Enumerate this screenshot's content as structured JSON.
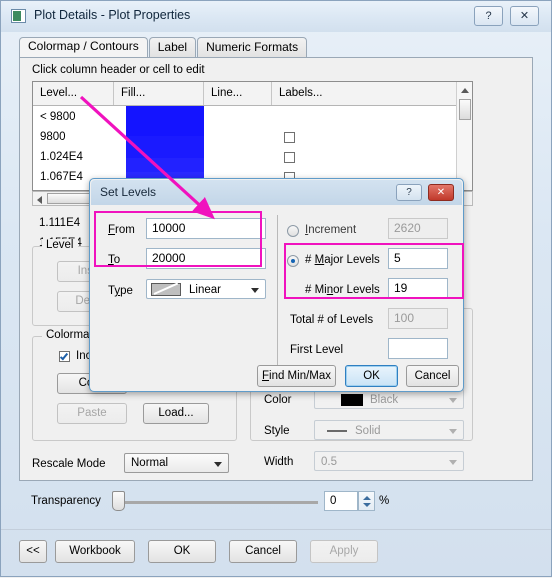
{
  "window": {
    "title": "Plot Details - Plot Properties",
    "help_label": "?",
    "close_label": "✕"
  },
  "tabs": [
    {
      "label": "Colormap / Contours",
      "active": true
    },
    {
      "label": "Label",
      "active": false
    },
    {
      "label": "Numeric Formats",
      "active": false
    }
  ],
  "panel": {
    "hint": "Click column header or cell to edit"
  },
  "grid": {
    "columns": [
      "Level...",
      "Fill...",
      "Line...",
      "Labels..."
    ],
    "rows": [
      {
        "level": "< 9800",
        "fill": "#1414ff",
        "labels_checkbox": false,
        "checkbox_visible": false
      },
      {
        "level": "9800",
        "fill": "#1414ff",
        "labels_checkbox": false,
        "checkbox_visible": true
      },
      {
        "level": "1.024E4",
        "fill": "#1a1aff",
        "labels_checkbox": false,
        "checkbox_visible": true
      },
      {
        "level": "1.067E4",
        "fill": "#2020ff",
        "labels_checkbox": false,
        "checkbox_visible": true
      },
      {
        "level": "1.111E4",
        "fill": "#2626ff",
        "labels_checkbox": false,
        "checkbox_visible": true
      },
      {
        "level": "1.155E4",
        "fill": "#2d2dff",
        "labels_checkbox": false,
        "checkbox_visible": true
      }
    ]
  },
  "level_group": {
    "title": "Level",
    "insert_label": "Insert",
    "delete_label": "Delete"
  },
  "colormap_group": {
    "title": "Colormap",
    "include_label": "Include",
    "include_checked": true,
    "copy_label": "Copy",
    "paste_label": "Paste",
    "load_label": "Load..."
  },
  "line_settings": {
    "color_label": "Color",
    "color_value": "Black",
    "color_swatch": "#000000",
    "style_label": "Style",
    "style_value": "Solid",
    "width_label": "Width",
    "width_value": "0.5"
  },
  "rescale": {
    "label": "Rescale Mode",
    "value": "Normal"
  },
  "transparency": {
    "label": "Transparency",
    "value": "0",
    "unit": "%"
  },
  "footer": {
    "back_label": "<<",
    "workbook_label": "Workbook",
    "ok_label": "OK",
    "cancel_label": "Cancel",
    "apply_label": "Apply"
  },
  "set_levels_dialog": {
    "title": "Set Levels",
    "help_label": "?",
    "close_label": "✕",
    "from_label": "From",
    "from_value": "10000",
    "to_label": "To",
    "to_value": "20000",
    "type_label": "Type",
    "type_value": "Linear",
    "increment_label": "Increment",
    "increment_value": "2620",
    "increment_selected": false,
    "major_levels_label": "# Major Levels",
    "major_levels_value": "5",
    "major_levels_selected": true,
    "minor_levels_label": "# Minor Levels",
    "minor_levels_value": "19",
    "total_levels_label": "Total # of Levels",
    "total_levels_value": "100",
    "first_level_label": "First Level",
    "first_level_value": "",
    "find_minmax_label": "Find Min/Max",
    "ok_label": "OK",
    "cancel_label": "Cancel"
  },
  "annotations": {
    "highlight_color": "#f012be",
    "arrow_from": "Level... column header",
    "arrow_to": "Set Levels dialog"
  }
}
